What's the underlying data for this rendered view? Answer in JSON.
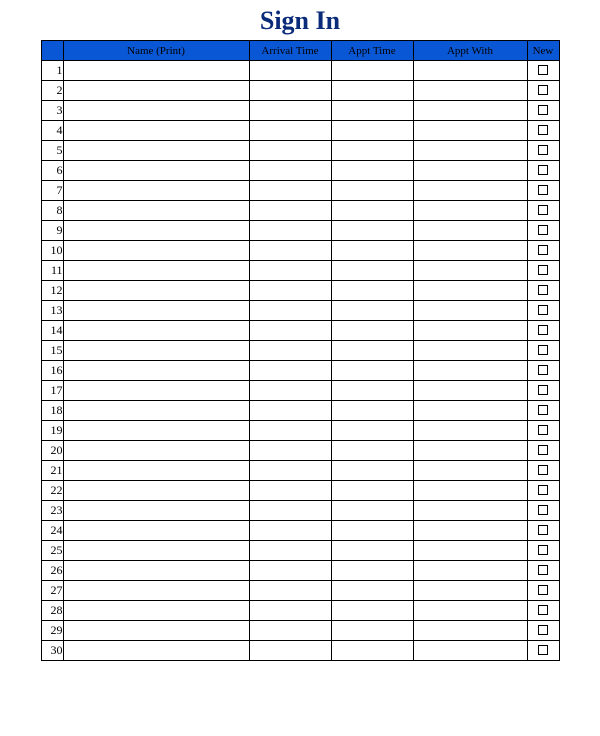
{
  "title": "Sign In",
  "columns": {
    "num": "",
    "name": "Name (Print)",
    "arrival": "Arrival Time",
    "appt": "Appt Time",
    "with": "Appt With",
    "new": "New"
  },
  "row_count": 30,
  "colors": {
    "header_bg": "#0a57d6",
    "title": "#0a2a7a"
  }
}
